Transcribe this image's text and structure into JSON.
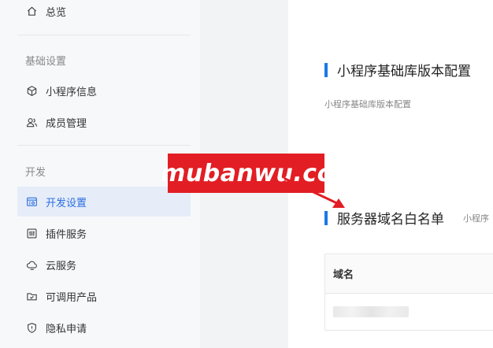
{
  "sidebar": {
    "overview": {
      "label": "总览",
      "icon": "home-icon"
    },
    "sections": [
      {
        "title": "基础设置"
      },
      {
        "title": "开发"
      }
    ],
    "items": [
      {
        "label": "小程序信息",
        "icon": "cube-icon"
      },
      {
        "label": "成员管理",
        "icon": "users-icon"
      },
      {
        "label": "开发设置",
        "icon": "dev-settings-icon",
        "active": true
      },
      {
        "label": "插件服务",
        "icon": "plugin-icon"
      },
      {
        "label": "云服务",
        "icon": "cloud-icon"
      },
      {
        "label": "可调用产品",
        "icon": "product-icon"
      },
      {
        "label": "隐私申请",
        "icon": "shield-icon"
      }
    ]
  },
  "main": {
    "lib_section": {
      "title": "小程序基础库版本配置",
      "description": "小程序基础库版本配置"
    },
    "domain_section": {
      "title": "服务器域名白名单",
      "description": "小程序"
    },
    "table": {
      "header": "域名"
    }
  },
  "watermark": {
    "text": "mubanwu.cc"
  },
  "colors": {
    "accent": "#2c6ee0",
    "heading_bar": "#1b78e6",
    "watermark_bg": "#e21e24",
    "active_bg": "#e6edf9"
  }
}
